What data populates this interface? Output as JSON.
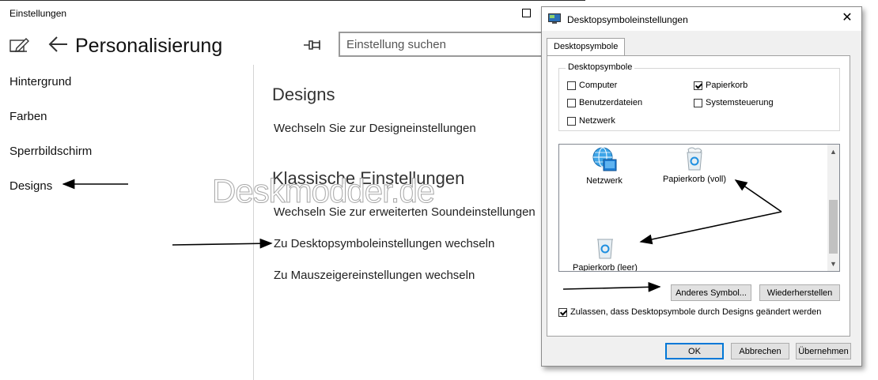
{
  "settings": {
    "window_title": "Einstellungen",
    "header_title": "Personalisierung",
    "search_placeholder": "Einstellung suchen",
    "sidebar": {
      "items": [
        {
          "label": "Hintergrund"
        },
        {
          "label": "Farben"
        },
        {
          "label": "Sperrbildschirm"
        },
        {
          "label": "Designs"
        }
      ]
    },
    "content": {
      "section1_title": "Designs",
      "section1_link": "Wechseln Sie zur Designeinstellungen",
      "section2_title": "Klassische Einstellungen",
      "links": [
        "Wechseln Sie zur erweiterten Soundeinstellungen",
        "Zu Desktopsymboleinstellungen wechseln",
        "Zu Mauszeigereinstellungen wechseln"
      ]
    },
    "watermark": "Deskmodder.de"
  },
  "dialog": {
    "title": "Desktopsymboleinstellungen",
    "close_glyph": "✕",
    "tab_label": "Desktopsymbole",
    "group_label": "Desktopsymbole",
    "checkboxes": [
      {
        "label": "Computer",
        "checked": false
      },
      {
        "label": "Papierkorb",
        "checked": true
      },
      {
        "label": "Benutzerdateien",
        "checked": false
      },
      {
        "label": "Systemsteuerung",
        "checked": false
      },
      {
        "label": "Netzwerk",
        "checked": false
      }
    ],
    "icons": [
      {
        "label": "Netzwerk",
        "icon": "network-icon"
      },
      {
        "label": "Papierkorb (voll)",
        "icon": "recycle-bin-full-icon"
      },
      {
        "label": "Papierkorb (leer)",
        "icon": "recycle-bin-empty-icon"
      }
    ],
    "change_icon_button": "Anderes Symbol...",
    "restore_button": "Wiederherstellen",
    "allow_themes_checkbox": {
      "label": "Zulassen, dass Desktopsymbole durch Designs geändert werden",
      "checked": true
    },
    "ok_button": "OK",
    "cancel_button": "Abbrechen",
    "apply_button": "Übernehmen"
  },
  "colors": {
    "accent": "#0078d7",
    "annotation_arrow": "#000000"
  }
}
